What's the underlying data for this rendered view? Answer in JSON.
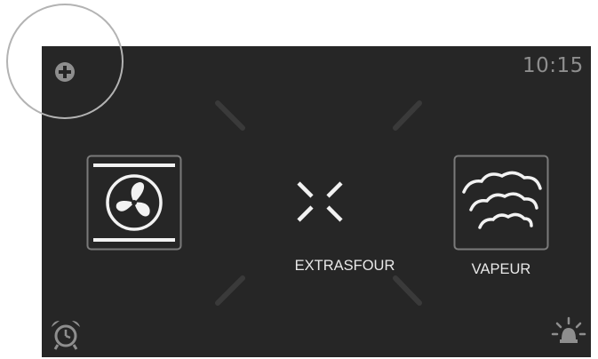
{
  "status_bar": {
    "time": "10:15"
  },
  "modes": [
    {
      "id": "convection",
      "label": "",
      "icon": "fan-icon"
    },
    {
      "id": "extrasfour",
      "label": "EXTRASFOUR",
      "icon": "extrasfour-icon"
    },
    {
      "id": "vapeur",
      "label": "VAPEUR",
      "icon": "steam-icon"
    }
  ],
  "toolbar": {
    "add_icon": "plus-circle-icon",
    "alarm_icon": "alarm-clock-icon",
    "light_icon": "oven-light-icon"
  },
  "colors": {
    "screen_bg": "#262626",
    "icon_gray": "#8e8e8e",
    "text_light": "#e8e8e8",
    "highlight": "#b3b3b3"
  }
}
